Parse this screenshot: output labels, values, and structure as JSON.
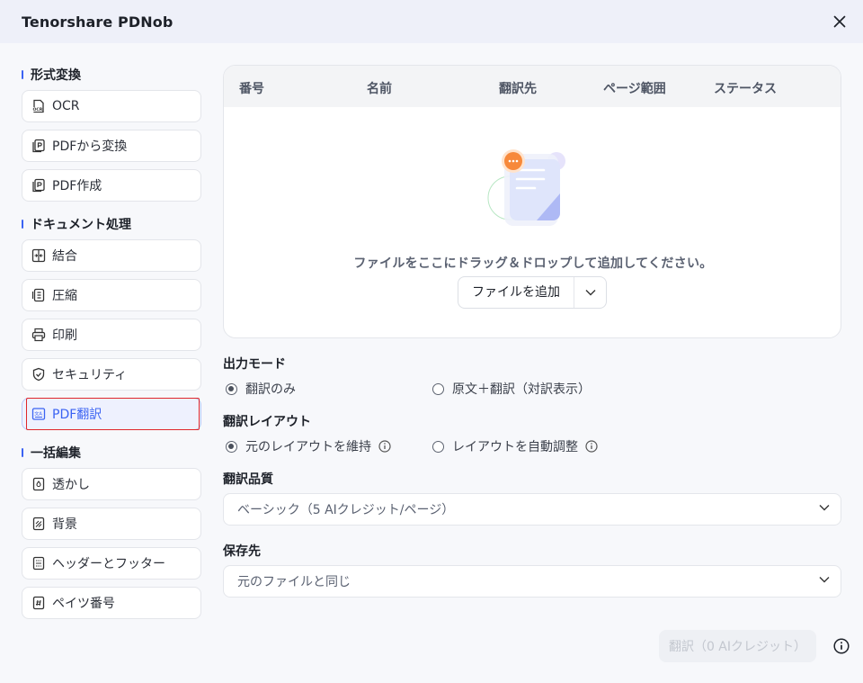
{
  "app": {
    "title": "Tenorshare PDNob"
  },
  "sidebar": {
    "sections": [
      {
        "title": "形式変換",
        "items": [
          {
            "label": "OCR",
            "icon": "ocr-icon"
          },
          {
            "label": "PDFから変換",
            "icon": "pdf-convert-icon"
          },
          {
            "label": "PDF作成",
            "icon": "pdf-create-icon"
          }
        ]
      },
      {
        "title": "ドキュメント処理",
        "items": [
          {
            "label": "結合",
            "icon": "merge-icon"
          },
          {
            "label": "圧縮",
            "icon": "compress-icon"
          },
          {
            "label": "印刷",
            "icon": "print-icon"
          },
          {
            "label": "セキュリティ",
            "icon": "shield-icon"
          },
          {
            "label": "PDF翻訳",
            "icon": "translate-icon",
            "active": true
          }
        ]
      },
      {
        "title": "一括編集",
        "items": [
          {
            "label": "透かし",
            "icon": "watermark-icon"
          },
          {
            "label": "背景",
            "icon": "background-icon"
          },
          {
            "label": "ヘッダーとフッター",
            "icon": "header-footer-icon"
          },
          {
            "label": "ペイツ番号",
            "icon": "page-number-icon"
          }
        ]
      }
    ]
  },
  "table": {
    "columns": [
      "番号",
      "名前",
      "翻訳先",
      "ページ範囲",
      "ステータス"
    ],
    "empty_text": "ファイルをここにドラッグ＆ドロップして追加してください。",
    "add_button": "ファイルを追加"
  },
  "output_mode": {
    "label": "出力モード",
    "options": [
      {
        "label": "翻訳のみ",
        "checked": true
      },
      {
        "label": "原文＋翻訳（対訳表示）",
        "checked": false
      }
    ]
  },
  "layout": {
    "label": "翻訳レイアウト",
    "options": [
      {
        "label": "元のレイアウトを維持",
        "checked": true
      },
      {
        "label": "レイアウトを自動調整",
        "checked": false
      }
    ]
  },
  "quality": {
    "label": "翻訳品質",
    "value": "ベーシック（5 AIクレジット/ページ）"
  },
  "save_to": {
    "label": "保存先",
    "value": "元のファイルと同じ"
  },
  "footer": {
    "translate_button": "翻訳（0 AIクレジット）"
  },
  "colors": {
    "accent": "#3b63f3",
    "highlight_box": "#e0262b",
    "titlebar_bg": "#eef0f9"
  }
}
